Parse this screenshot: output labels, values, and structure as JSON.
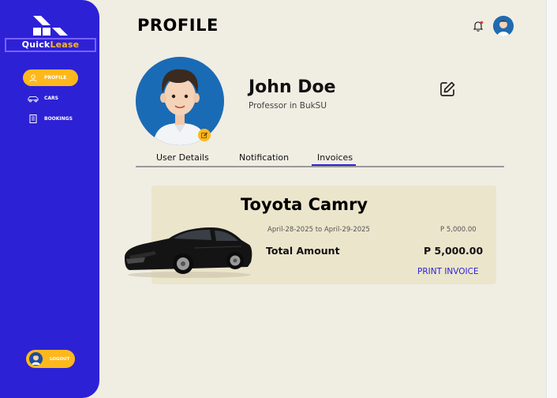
{
  "app": {
    "logo_word1": "Quick",
    "logo_word2": "Lease"
  },
  "sidebar": {
    "items": [
      {
        "label": "PROFILE",
        "icon": "user-icon",
        "active": true
      },
      {
        "label": "CARS",
        "icon": "car-icon",
        "active": false
      },
      {
        "label": "BOOKINGS",
        "icon": "book-icon",
        "active": false
      }
    ],
    "logout_label": "LOGOUT"
  },
  "header": {
    "title": "PROFILE",
    "notification_icon": "bell-icon"
  },
  "profile": {
    "name": "John Doe",
    "role": "Professor in BukSU"
  },
  "tabs": [
    {
      "label": "User Details",
      "active": false
    },
    {
      "label": "Notification",
      "active": false
    },
    {
      "label": "Invoices",
      "active": true
    }
  ],
  "invoice": {
    "car_name": "Toyota Camry",
    "date_range": "April-28-2025 to April-29-2025",
    "line_price": "P 5,000.00",
    "total_label": "Total Amount",
    "total_value": "P 5,000.00",
    "print_label": "PRINT INVOICE"
  },
  "colors": {
    "brand": "#2d21d6",
    "accent": "#ffb81c",
    "background": "#f0ede3",
    "card": "#ebe5cc"
  }
}
